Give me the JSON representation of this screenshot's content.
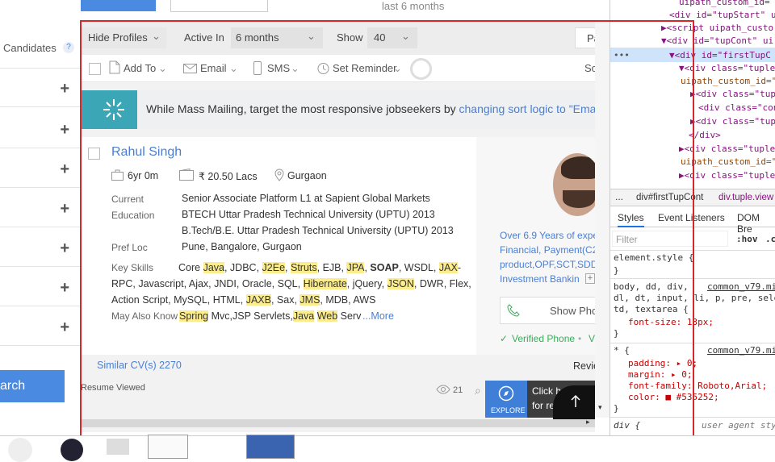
{
  "top": {
    "last_text": "last 6 months"
  },
  "sidebar": {
    "candidates_label": "Candidates",
    "help_glyph": "?",
    "plus_glyph": "+",
    "search_label": "arch"
  },
  "toolbar": {
    "hide_profiles": "Hide Profiles",
    "active_in_label": "Active In",
    "active_in_value": "6 months",
    "show_label": "Show",
    "show_value": "40",
    "pa_label": "Pa"
  },
  "actions": {
    "add_to": "Add To",
    "email": "Email",
    "sms": "SMS",
    "set_reminder": "Set Reminder",
    "so_label": "So"
  },
  "banner": {
    "text": "While Mass Mailing, target the most responsive jobseekers by ",
    "link": "changing sort logic to \"Ema"
  },
  "candidate": {
    "name": "Rahul Singh",
    "experience": "6yr 0m",
    "salary": "₹ 20.50 Lacs",
    "location": "Gurgaon",
    "current_label": "Current",
    "current_value": "Senior Associate Platform L1 at Sapient Global Markets",
    "education_label": "Education",
    "education_1": "BTECH Uttar Pradesh Technical University (UPTU) 2013",
    "education_2": "B.Tech/B.E. Uttar Pradesh Technical University (UPTU) 2013",
    "pref_loc_label": "Pref Loc",
    "pref_loc_value": "Pune, Bangalore, Gurgaon",
    "key_skills_label": "Key Skills",
    "may_also_know_label": "May Also Know",
    "more_link": "...More",
    "summary_1": "Over 6.9 Years of expe",
    "summary_2": "Financial, Payment(C2",
    "summary_3": "product,OPF,SCT,SDD,",
    "summary_4": "Investment Bankin",
    "show_phone": "Show Pho",
    "verified_phone": "Verified Phone",
    "verified_dot": "•",
    "verified_v": "V",
    "similar_cvs": "Similar CV(s) 2270",
    "review": "Revie",
    "resume_viewed": "Resume Viewed",
    "views": "21",
    "explore": "EXPLORE",
    "click_line1": "Click h",
    "click_line2": "for re"
  },
  "skills": {
    "line1": [
      [
        "Core ",
        false
      ],
      [
        "Java",
        true
      ],
      [
        ", JDBC, ",
        false
      ],
      [
        "J2Ee",
        true
      ],
      [
        ", ",
        false
      ],
      [
        "Struts",
        true
      ],
      [
        ", EJB, ",
        false
      ],
      [
        "JPA",
        true
      ],
      [
        ", ",
        false
      ],
      [
        "SOAP",
        "bold"
      ],
      [
        ", WSDL, ",
        false
      ],
      [
        "JAX",
        true
      ],
      [
        "-",
        false
      ]
    ],
    "line2": [
      [
        "RPC, Javascript, Ajax, JNDI, Oracle, SQL, ",
        false
      ],
      [
        "Hibernate",
        true
      ],
      [
        ", jQuery, ",
        false
      ],
      [
        "JSON",
        true
      ],
      [
        ", DWR, Flex,",
        false
      ]
    ],
    "line3": [
      [
        "Action Script, MySQL, HTML, ",
        false
      ],
      [
        "JAXB",
        true
      ],
      [
        ", Sax, ",
        false
      ],
      [
        "JMS",
        true
      ],
      [
        ", MDB, AWS",
        false
      ]
    ],
    "may_also": [
      [
        "Spring",
        true
      ],
      [
        " Mvc,JSP Servlets,",
        false
      ],
      [
        "Java",
        true
      ],
      [
        " ",
        false
      ],
      [
        "Web",
        true
      ],
      [
        " Serv",
        false
      ]
    ]
  },
  "devtools": {
    "lines": [
      "uipath_custom_id= li",
      "<div id=\"tupStart\" ui",
      "▶<script uipath_custo",
      "▼<div id=\"tupCont\" ui",
      "▼<div id=\"firstTupC",
      "▼<div class=\"tuple",
      "uipath_custom_id=\"",
      "▶<div class=\"tup",
      "<div class=\"con",
      "▶<div class=\"tup",
      "</div>",
      "▶<div class=\"tuple",
      "uipath_custom_id=\"",
      "▶<div class=\"tuple"
    ],
    "breadcrumb_1": "div#firstTupCont",
    "breadcrumb_2": "div.tuple.view",
    "tab_styles": "Styles",
    "tab_listeners": "Event Listeners",
    "tab_dom": "DOM Bre",
    "filter_placeholder": "Filter",
    "hov": ":hov",
    "cls": ".c",
    "element_style": "element.style {",
    "close_brace": "}",
    "rule1_selector_1": "body, dd, div,",
    "rule1_source": "common_v79.mi",
    "rule1_selector_2": "dl, dt, input, li, p, pre, sele",
    "rule1_selector_3": "td, textarea {",
    "rule1_prop": "font-size: 13px;",
    "rule2_selector": "* {",
    "rule2_source": "common_v79.mi",
    "rule2_padding": "padding: ▸ 0;",
    "rule2_margin": "margin: ▸ 0;",
    "rule2_font": "font-family: Roboto,Arial;",
    "rule2_color": "color: ■ #535252;",
    "rule3_selector": "div {",
    "rule3_source": "user agent sty"
  }
}
